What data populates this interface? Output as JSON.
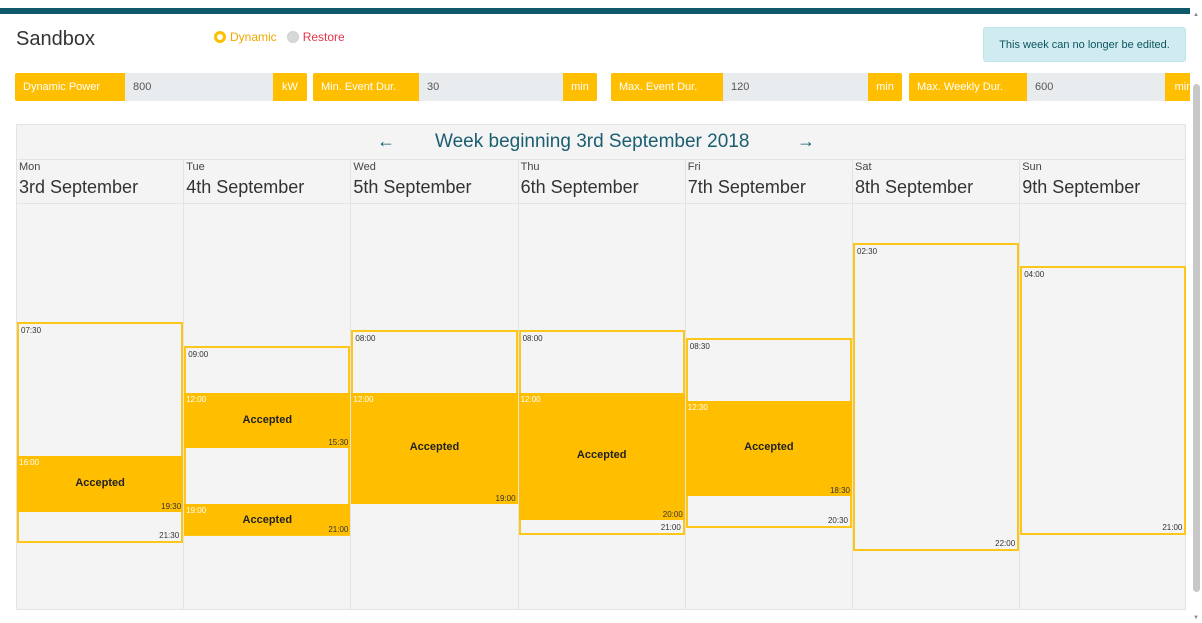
{
  "header": {
    "title": "Sandbox"
  },
  "mode": {
    "options": [
      {
        "label": "Dynamic",
        "selected": true
      },
      {
        "label": "Restore",
        "selected": false
      }
    ]
  },
  "alert": {
    "text": "This week can no longer be edited."
  },
  "params": [
    {
      "label": "Dynamic Power",
      "value": "800",
      "unit": "kW"
    },
    {
      "label": "Min. Event Dur.",
      "value": "30",
      "unit": "min"
    },
    {
      "label": "Max. Event Dur.",
      "value": "120",
      "unit": "min"
    },
    {
      "label": "Max. Weekly Dur.",
      "value": "600",
      "unit": "min"
    }
  ],
  "calendar": {
    "week_title": "Week beginning 3rd September 2018",
    "prev_icon": "arrow-left-icon",
    "next_icon": "arrow-right-icon",
    "prev_glyph": "←",
    "next_glyph": "→",
    "days": [
      {
        "name": "Mon",
        "date": "3rd September",
        "window_start": "07:30",
        "window_end": "21:30",
        "events": [
          {
            "start": "16:00",
            "end": "19:30",
            "label": "Accepted"
          }
        ]
      },
      {
        "name": "Tue",
        "date": "4th September",
        "window_start": "09:00",
        "window_end": "21:00",
        "events": [
          {
            "start": "12:00",
            "end": "15:30",
            "label": "Accepted"
          },
          {
            "start": "19:00",
            "end": "21:00",
            "label": "Accepted"
          }
        ]
      },
      {
        "name": "Wed",
        "date": "5th September",
        "window_start": "08:00",
        "window_end": "19:00",
        "events": [
          {
            "start": "12:00",
            "end": "19:00",
            "label": "Accepted"
          }
        ]
      },
      {
        "name": "Thu",
        "date": "6th September",
        "window_start": "08:00",
        "window_end": "21:00",
        "events": [
          {
            "start": "12:00",
            "end": "20:00",
            "label": "Accepted"
          }
        ]
      },
      {
        "name": "Fri",
        "date": "7th September",
        "window_start": "08:30",
        "window_end": "20:30",
        "events": [
          {
            "start": "12:30",
            "end": "18:30",
            "label": "Accepted"
          }
        ]
      },
      {
        "name": "Sat",
        "date": "8th September",
        "window_start": "02:30",
        "window_end": "22:00",
        "events": []
      },
      {
        "name": "Sun",
        "date": "9th September",
        "window_start": "04:00",
        "window_end": "21:00",
        "events": []
      }
    ]
  },
  "colors": {
    "accent": "#ffbf00",
    "header_bar": "#0e5a6b",
    "title_blue": "#1a5e70",
    "alert_bg": "#d1ecf1"
  }
}
